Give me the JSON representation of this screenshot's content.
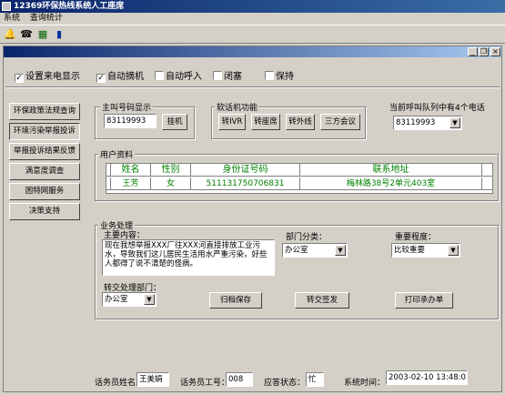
{
  "window": {
    "title": "12369环保热线系统人工座席"
  },
  "menu": [
    "系统",
    "查询统计"
  ],
  "options": {
    "caller_id": "设置来电显示",
    "auto_pickup": "自动摘机",
    "auto_call_in": "自动呼入",
    "do_not_disturb": "闭塞",
    "hold": "保持"
  },
  "nav": [
    "环保政策法规查询",
    "环境污染举报投诉",
    "举报投诉结果反馈",
    "满意度调查",
    "困特网服务",
    "决策支持"
  ],
  "main_number": {
    "legend": "主叫号码显示",
    "value": "83119993",
    "hangup": "挂机"
  },
  "soft_phone": {
    "legend": "软话机功能",
    "buttons": [
      "转IVR",
      "转座席",
      "转外线",
      "三方会议"
    ]
  },
  "queue": {
    "label": "当前呼叫队列中有4个电话",
    "selected": "83119993"
  },
  "user_info": {
    "legend": "用户资料",
    "headers": [
      "姓名",
      "性别",
      "身份证号码",
      "联系地址"
    ],
    "rows": [
      {
        "name": "王芳",
        "gender": "女",
        "id": "511131750706831",
        "address": "梅林路38号2单元403室"
      }
    ]
  },
  "business": {
    "legend": "业务处理",
    "content_label": "主要内容：",
    "content": "现在我想举报XXX厂往XXX河直接排放工业污水，导致我们这儿居民生活用水严重污染，好些人都得了说不清楚的怪病。",
    "dept_label": "部门分类：",
    "dept_value": "办公室",
    "importance_label": "重要程度：",
    "importance_value": "比较重要",
    "transfer_label": "转交处理部门：",
    "transfer_value": "办公室",
    "buttons": {
      "archive": "归档保存",
      "transfer": "转交签发",
      "print": "打印承办单"
    }
  },
  "status": {
    "operator_name_label": "话务员姓名",
    "operator_name": "王美娟",
    "operator_id_label": "话务员工号：",
    "operator_id": "008",
    "state_label": "应答状态：",
    "state": "忙",
    "time_label": "系统时间：",
    "time": "2003-02-10 13:48:03"
  },
  "colors": {
    "title": "#0a246a",
    "row_text": "#008000",
    "header_text": "#008000"
  },
  "icons": [
    "bell-icon",
    "phone-icon",
    "network-icon",
    "chart-icon"
  ]
}
